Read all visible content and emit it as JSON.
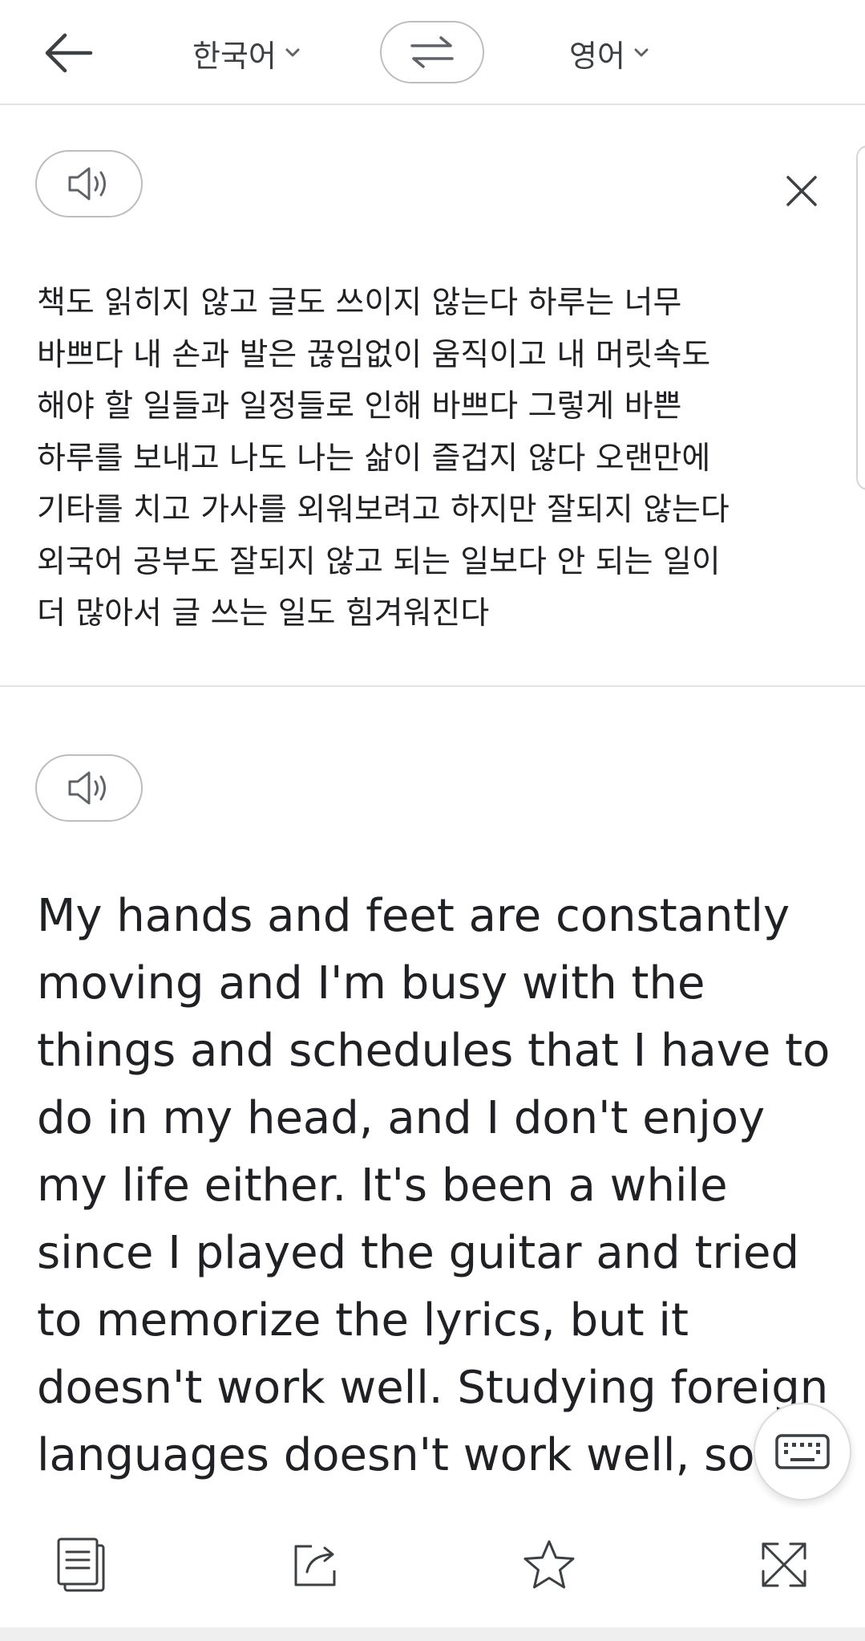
{
  "header": {
    "back_icon": "arrow-left-icon",
    "source_language": "한국어",
    "target_language": "영어",
    "swap_icon": "swap-arrows-icon"
  },
  "source": {
    "speak_icon": "speaker-icon",
    "close_icon": "close-icon",
    "text": "책도 읽히지 않고 글도 쓰이지 않는다 하루는 너무\n바쁘다 내 손과 발은 끊임없이 움직이고 내 머릿속도\n해야 할 일들과 일정들로 인해 바쁘다 그렇게 바쁜\n하루를 보내고 나도 나는 삶이 즐겁지 않다 오랜만에\n기타를 치고 가사를 외워보려고 하지만 잘되지 않는다\n외국어 공부도 잘되지 않고 되는 일보다 안 되는 일이\n더 많아서 글 쓰는 일도 힘겨워진다"
  },
  "translation": {
    "speak_icon": "speaker-icon",
    "text": "My hands and feet are constantly moving and I'm busy with the things and schedules that I have to do in my head, and I don't enjoy my life either. It's been a while since I played the guitar and tried to memorize the lyrics, but it doesn't work well. Studying foreign languages doesn't work well, so"
  },
  "keyboard_icon": "keyboard-icon",
  "toolbar": {
    "copy_icon": "copy-icon",
    "share_icon": "share-icon",
    "favorite_icon": "star-icon",
    "fullscreen_icon": "expand-icon"
  },
  "colors": {
    "text": "#202124",
    "icon": "#3c4043",
    "border": "#bdbdbd",
    "divider": "#e3e3e3"
  }
}
